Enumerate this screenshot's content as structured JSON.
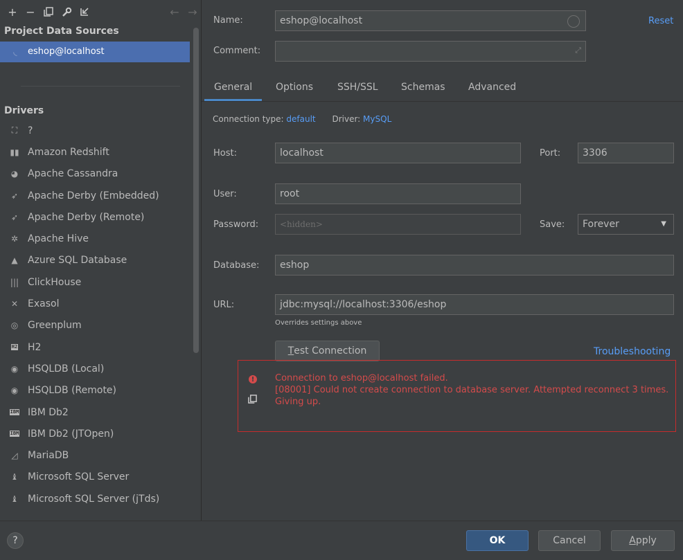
{
  "toolbar": {
    "add_icon": "+",
    "remove_icon": "−",
    "duplicate_icon": "⧉",
    "properties_icon": "wrench",
    "import_icon": "↙",
    "back_icon": "←",
    "forward_icon": "→"
  },
  "left": {
    "project_title": "Project Data Sources",
    "data_source": "eshop@localhost",
    "drivers_title": "Drivers",
    "drivers": [
      {
        "label": "?",
        "icon": "unknown-driver-icon"
      },
      {
        "label": "Amazon Redshift",
        "icon": "redshift-icon"
      },
      {
        "label": "Apache Cassandra",
        "icon": "cassandra-icon"
      },
      {
        "label": "Apache Derby (Embedded)",
        "icon": "derby-icon"
      },
      {
        "label": "Apache Derby (Remote)",
        "icon": "derby-icon"
      },
      {
        "label": "Apache Hive",
        "icon": "hive-icon"
      },
      {
        "label": "Azure SQL Database",
        "icon": "azure-icon"
      },
      {
        "label": "ClickHouse",
        "icon": "clickhouse-icon"
      },
      {
        "label": "Exasol",
        "icon": "exasol-icon"
      },
      {
        "label": "Greenplum",
        "icon": "greenplum-icon"
      },
      {
        "label": "H2",
        "icon": "h2-icon"
      },
      {
        "label": "HSQLDB (Local)",
        "icon": "hsqldb-icon"
      },
      {
        "label": "HSQLDB (Remote)",
        "icon": "hsqldb-icon"
      },
      {
        "label": "IBM Db2",
        "icon": "ibm-db2-icon"
      },
      {
        "label": "IBM Db2 (JTOpen)",
        "icon": "ibm-db2-icon"
      },
      {
        "label": "MariaDB",
        "icon": "mariadb-icon"
      },
      {
        "label": "Microsoft SQL Server",
        "icon": "mssql-icon"
      },
      {
        "label": "Microsoft SQL Server (jTds)",
        "icon": "mssql-icon"
      }
    ]
  },
  "form": {
    "name_label": "Name:",
    "name_value": "eshop@localhost",
    "reset_link": "Reset",
    "comment_label": "Comment:",
    "comment_value": "",
    "tabs": [
      "General",
      "Options",
      "SSH/SSL",
      "Schemas",
      "Advanced"
    ],
    "conn_type_label": "Connection type:",
    "conn_type_value": "default",
    "driver_label": "Driver:",
    "driver_value": "MySQL",
    "host_label": "Host:",
    "host_value": "localhost",
    "port_label": "Port:",
    "port_value": "3306",
    "user_label": "User:",
    "user_value": "root",
    "password_label": "Password:",
    "password_placeholder": "<hidden>",
    "save_label": "Save:",
    "save_value": "Forever",
    "database_label": "Database:",
    "database_value": "eshop",
    "url_label": "URL:",
    "url_value": "jdbc:mysql://localhost:3306/eshop",
    "url_hint": "Overrides settings above",
    "test_connection_pre": "",
    "test_connection_mnemonic": "T",
    "test_connection_post": "est Connection",
    "troubleshooting_link": "Troubleshooting"
  },
  "error": {
    "line1": "Connection to eshop@localhost failed.",
    "line2": "[08001] Could not create connection to database server. Attempted reconnect 3 times. Giving up.",
    "color": "#d44b4b"
  },
  "bottom": {
    "help": "?",
    "ok": "OK",
    "cancel": "Cancel",
    "apply_mnemonic": "A",
    "apply_rest": "pply"
  },
  "colors": {
    "selection": "#4b6eaf",
    "link": "#589df6",
    "tab_underline": "#4a88c7",
    "ok_button": "#365880"
  }
}
